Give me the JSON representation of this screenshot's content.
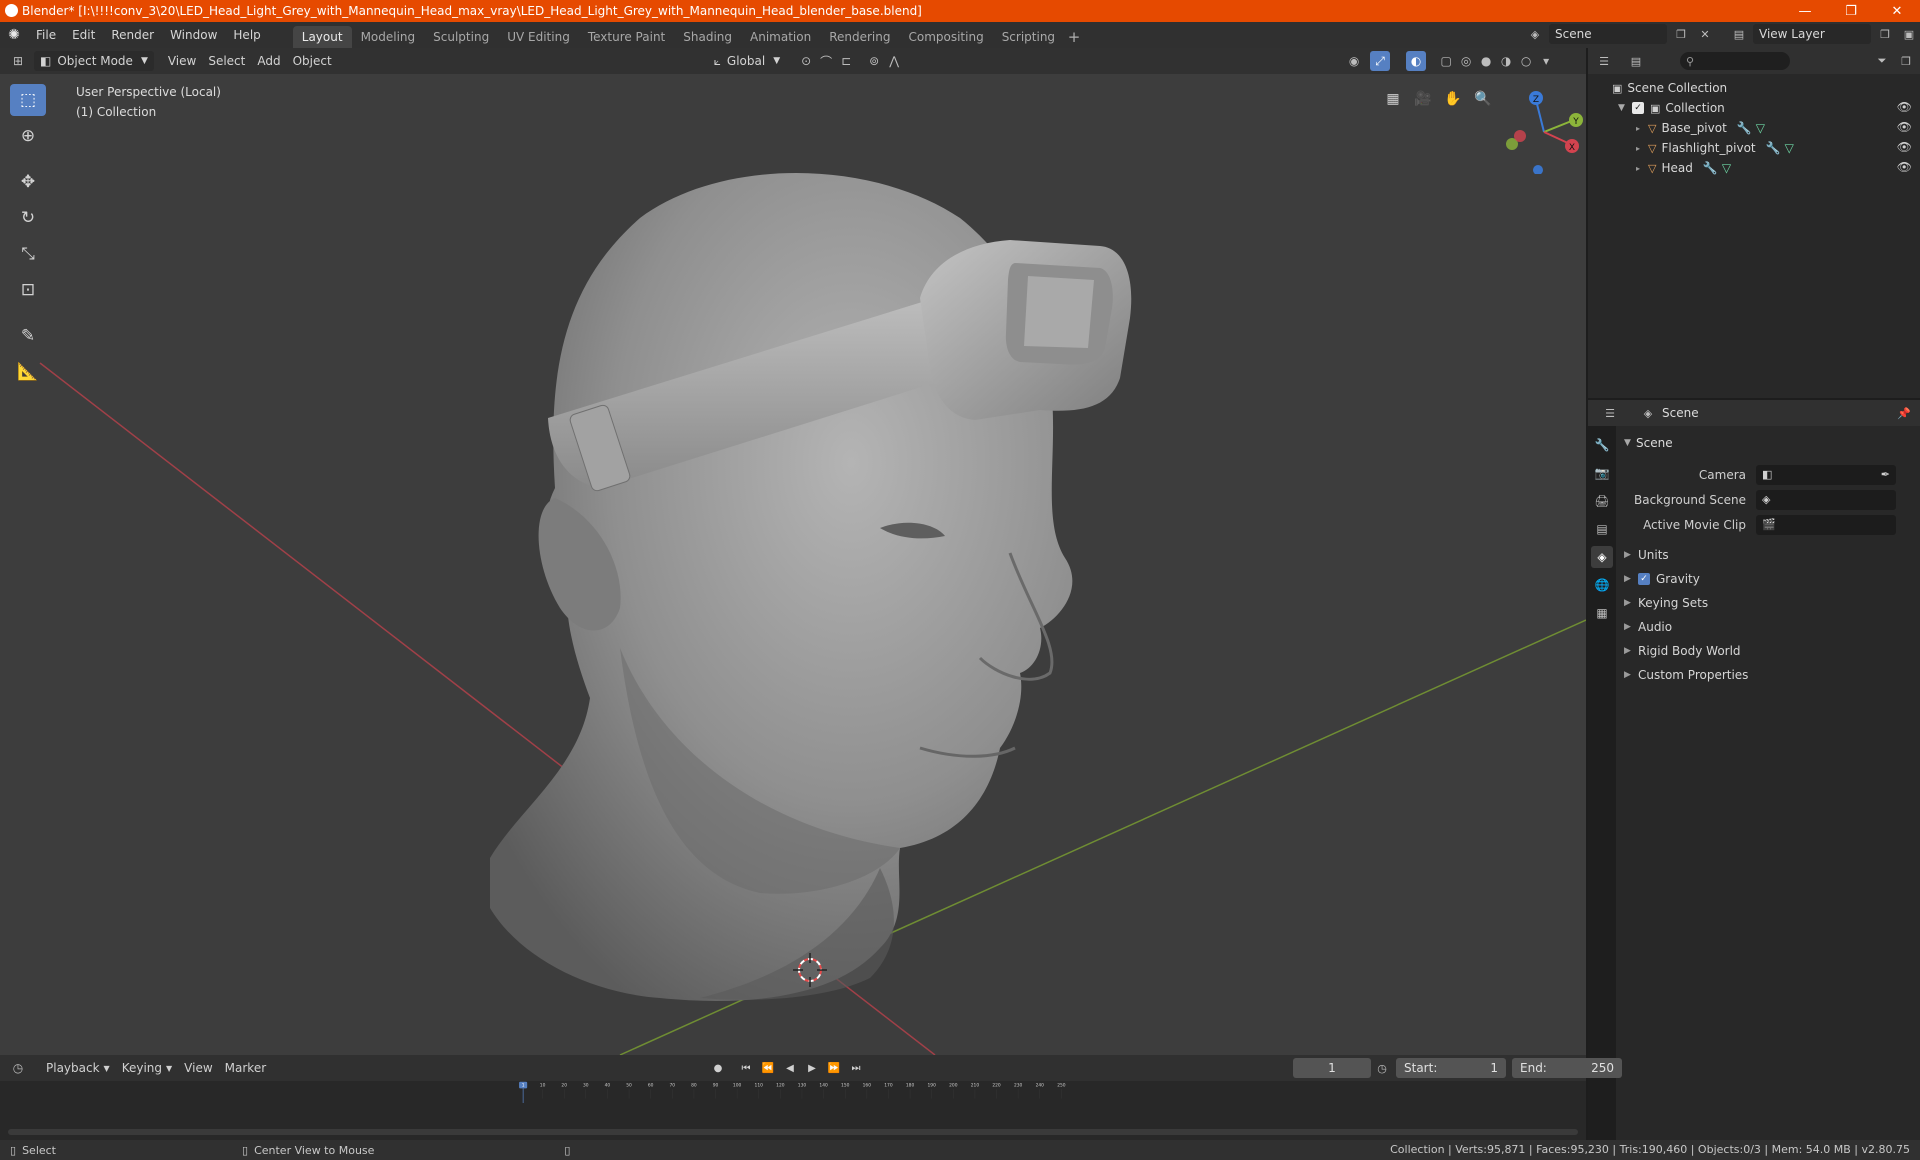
{
  "window": {
    "title": "Blender* [I:\\!!!!conv_3\\20\\LED_Head_Light_Grey_with_Mannequin_Head_max_vray\\LED_Head_Light_Grey_with_Mannequin_Head_blender_base.blend]",
    "controls": [
      "—",
      "❐",
      "✕"
    ]
  },
  "menu": [
    "File",
    "Edit",
    "Render",
    "Window",
    "Help"
  ],
  "workspaces": {
    "tabs": [
      "Layout",
      "Modeling",
      "Sculpting",
      "UV Editing",
      "Texture Paint",
      "Shading",
      "Animation",
      "Rendering",
      "Compositing",
      "Scripting"
    ],
    "active": "Layout",
    "add": "+"
  },
  "scene_selector": {
    "scene": "Scene",
    "view_layer": "View Layer"
  },
  "viewport": {
    "mode": "Object Mode",
    "menus": [
      "View",
      "Select",
      "Add",
      "Object"
    ],
    "transform_orientation": "Global",
    "info_line1": "User Perspective (Local)",
    "info_line2": "(1) Collection",
    "gizmo_labels": {
      "x": "X",
      "y": "Y",
      "z": "Z"
    }
  },
  "outliner": {
    "root": "Scene Collection",
    "collection": "Collection",
    "objects": [
      "Base_pivot",
      "Flashlight_pivot",
      "Head"
    ]
  },
  "properties": {
    "context": "Scene",
    "panel": "Scene",
    "rows": [
      {
        "label": "Camera"
      },
      {
        "label": "Background Scene"
      },
      {
        "label": "Active Movie Clip"
      }
    ],
    "sections": [
      "Units",
      "Gravity",
      "Keying Sets",
      "Audio",
      "Rigid Body World",
      "Custom Properties"
    ]
  },
  "timeline": {
    "menus": [
      "Playback",
      "Keying",
      "View",
      "Marker"
    ],
    "current_frame": "1",
    "start_label": "Start:",
    "start": "1",
    "end_label": "End:",
    "end": "250",
    "ticks": [
      "10",
      "20",
      "30",
      "40",
      "50",
      "60",
      "70",
      "80",
      "90",
      "100",
      "110",
      "120",
      "130",
      "140",
      "150",
      "160",
      "170",
      "180",
      "190",
      "200",
      "210",
      "220",
      "230",
      "240",
      "250"
    ],
    "current_marker": "1"
  },
  "statusbar": {
    "select": "Select",
    "center": "Center View to Mouse",
    "stats": "Collection | Verts:95,871 | Faces:95,230 | Tris:190,460 | Objects:0/3 | Mem: 54.0 MB | v2.80.75"
  },
  "colors": {
    "accent": "#5680c2",
    "titlebar": "#e64a00",
    "x_axis": "#d3434f",
    "y_axis": "#8cb53a",
    "z_axis": "#3a7ad8"
  }
}
